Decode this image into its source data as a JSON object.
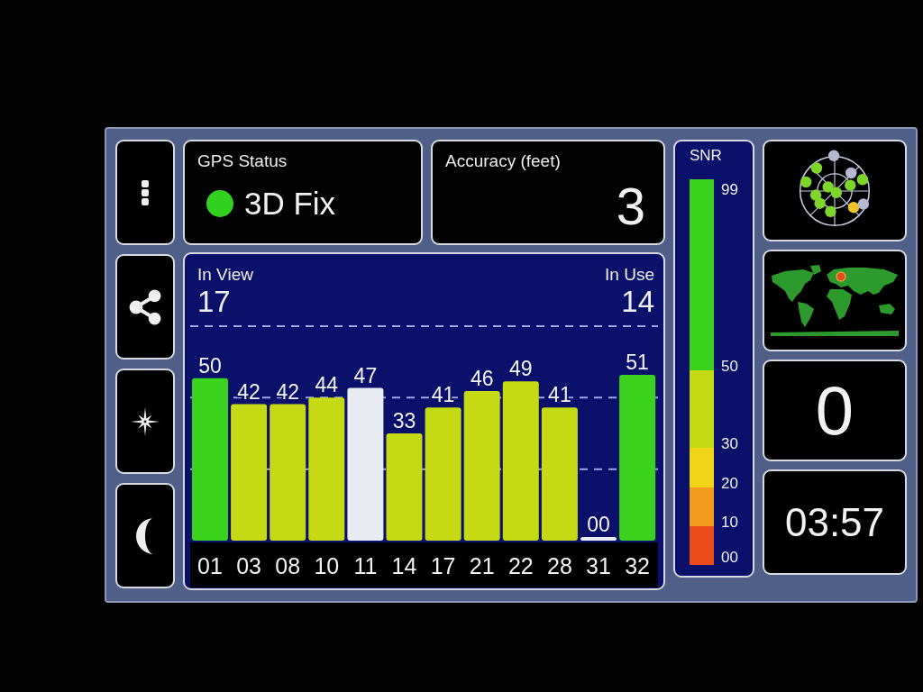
{
  "gps_status": {
    "label": "GPS Status",
    "value": "3D Fix",
    "color": "#33d11f"
  },
  "accuracy": {
    "label": "Accuracy (feet)",
    "value": "3"
  },
  "satellites": {
    "in_view": {
      "label": "In View",
      "value": "17"
    },
    "in_use": {
      "label": "In Use",
      "value": "14"
    },
    "used_in_fix": [
      true,
      true,
      true,
      true,
      false,
      true,
      true,
      true,
      true,
      true,
      false,
      true
    ],
    "chart_data": {
      "type": "bar",
      "categories": [
        "01",
        "03",
        "08",
        "10",
        "11",
        "14",
        "17",
        "21",
        "22",
        "28",
        "31",
        "32"
      ],
      "values": [
        50,
        42,
        42,
        44,
        47,
        33,
        41,
        46,
        49,
        41,
        0,
        51
      ],
      "value_labels": [
        "50",
        "42",
        "42",
        "44",
        "47",
        "33",
        "41",
        "46",
        "49",
        "41",
        "00",
        "51"
      ]
    }
  },
  "snr_legend": {
    "title": "SNR",
    "bands": [
      {
        "label": "99",
        "color": "#3ad21c"
      },
      {
        "label": "50",
        "color": "#c6d915"
      },
      {
        "label": "30",
        "color": "#f2d416"
      },
      {
        "label": "20",
        "color": "#f49a1e"
      },
      {
        "label": "10",
        "color": "#ee4b1a"
      }
    ],
    "bottom_label": "00"
  },
  "readouts": {
    "big_value": "0",
    "time": "03:57"
  }
}
